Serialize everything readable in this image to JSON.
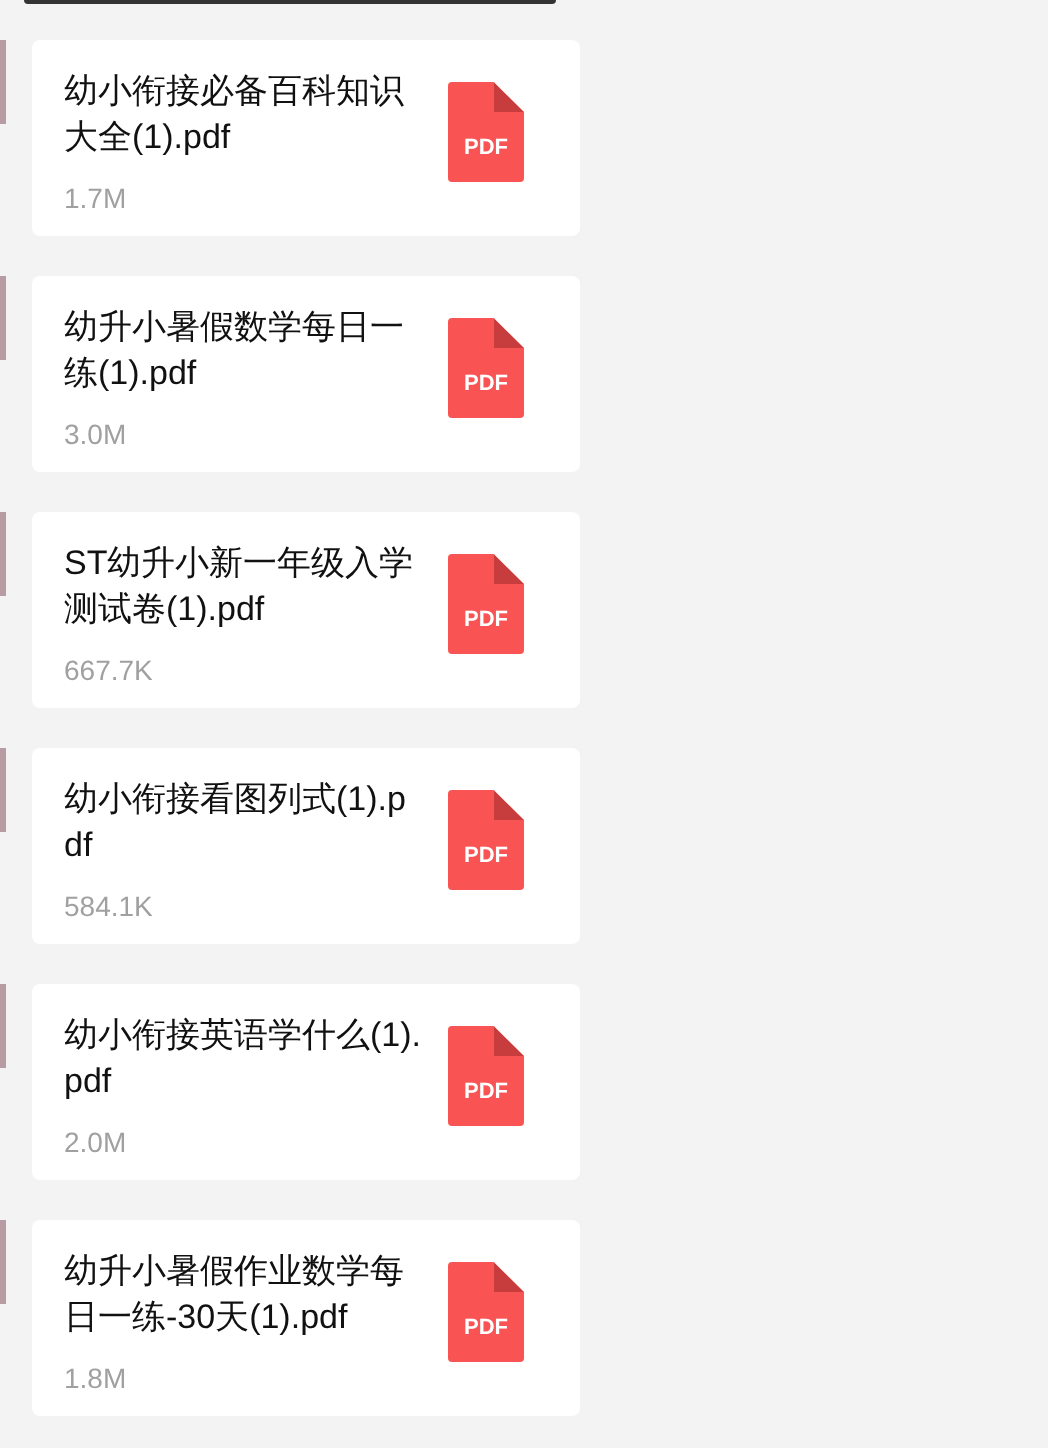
{
  "messages": [
    {
      "kind": "file",
      "name": "幼小衔接必备百科知识大全(1).pdf",
      "size": "1.7M",
      "icon_label": "PDF"
    },
    {
      "kind": "file",
      "name": "幼升小暑假数学每日一练(1).pdf",
      "size": "3.0M",
      "icon_label": "PDF"
    },
    {
      "kind": "file",
      "name": "ST幼升小新一年级入学测试卷(1).pdf",
      "size": "667.7K",
      "icon_label": "PDF"
    },
    {
      "kind": "file",
      "name": "幼小衔接看图列式(1).pdf",
      "size": "584.1K",
      "icon_label": "PDF"
    },
    {
      "kind": "file",
      "name": "幼小衔接英语学什么(1).pdf",
      "size": "2.0M",
      "icon_label": "PDF"
    },
    {
      "kind": "file",
      "name": "幼升小暑假作业数学每日一练-30天(1).pdf",
      "size": "1.8M",
      "icon_label": "PDF"
    }
  ]
}
